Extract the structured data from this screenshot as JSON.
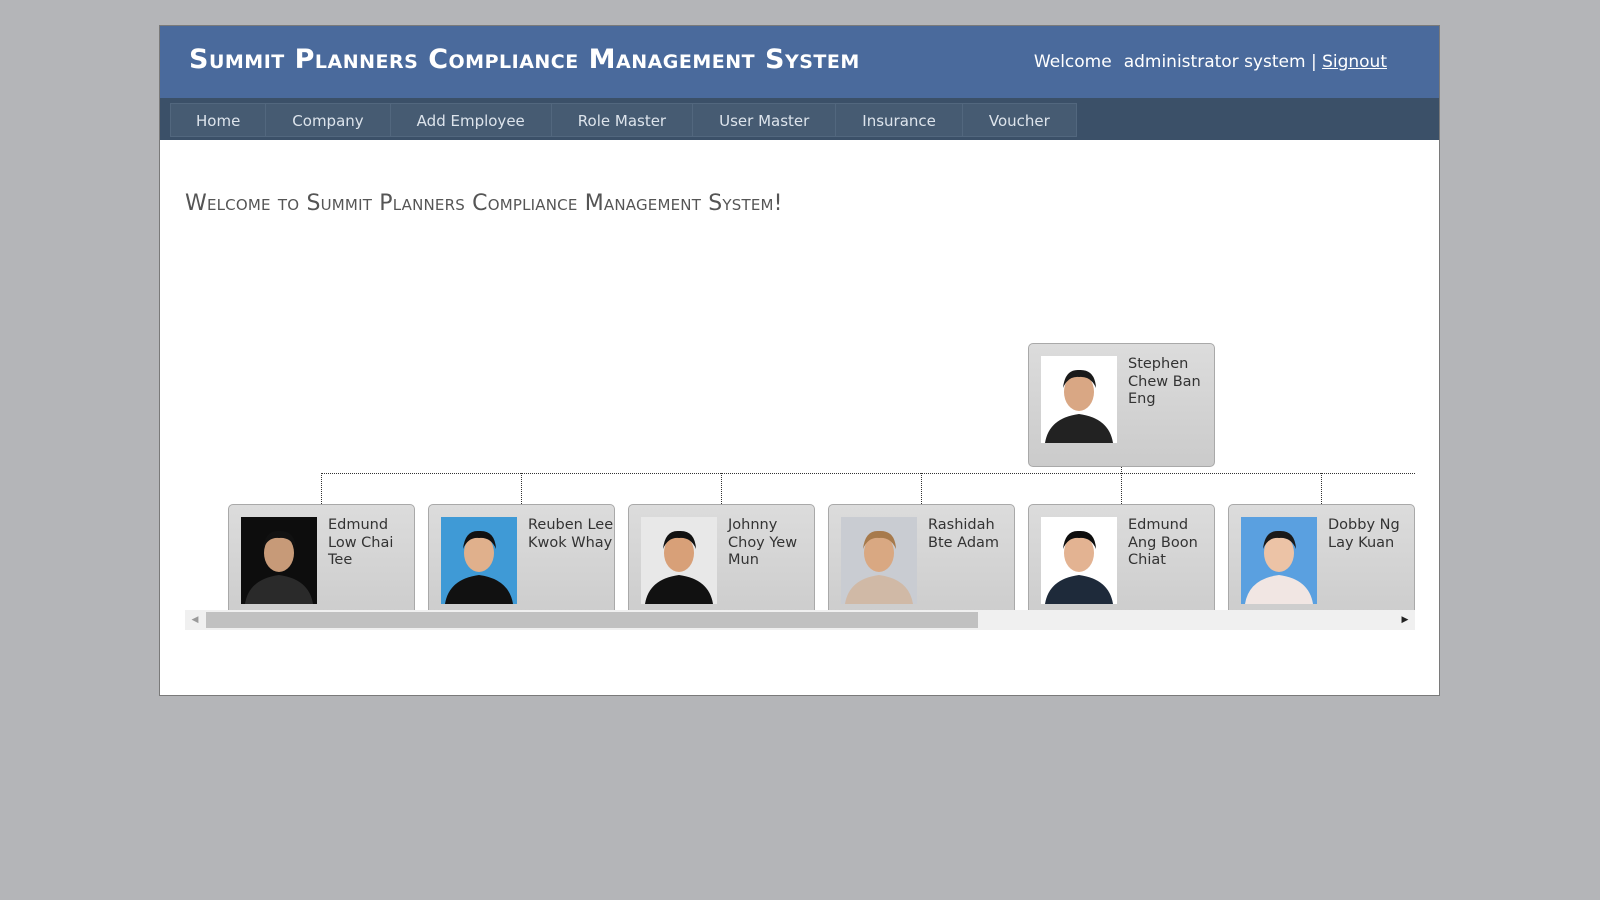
{
  "header": {
    "app_title": "Summit Planners Compliance Management System",
    "welcome_label": "Welcome",
    "username": "administrator system",
    "separator": "|",
    "signout_label": "Signout"
  },
  "nav": {
    "items": [
      {
        "label": "Home"
      },
      {
        "label": "Company"
      },
      {
        "label": "Add Employee"
      },
      {
        "label": "Role Master"
      },
      {
        "label": "User Master"
      },
      {
        "label": "Insurance"
      },
      {
        "label": "Voucher"
      }
    ]
  },
  "main": {
    "heading": "Welcome to Summit Planners Compliance Management System!"
  },
  "org_chart": {
    "root": {
      "name": "Stephen Chew Ban Eng",
      "photo": "portrait-man-glasses-white-bg"
    },
    "children": [
      {
        "name": "Edmund Low Chai Tee",
        "photo": "portrait-man-dark-bg"
      },
      {
        "name": "Reuben Lee Kwok Whay",
        "photo": "portrait-man-blue-bg"
      },
      {
        "name": "Johnny Choy Yew Mun",
        "photo": "portrait-man-tuxedo"
      },
      {
        "name": "Rashidah Bte Adam",
        "photo": "portrait-woman-long-hair"
      },
      {
        "name": "Edmund Ang Boon Chiat",
        "photo": "portrait-man-white-bg"
      },
      {
        "name": "Dobby Ng Lay Kuan",
        "photo": "portrait-woman-blue-bg"
      }
    ],
    "scroll_position_fraction": 0.0,
    "visible_fraction": 0.65
  },
  "icons": {
    "scroll_left": "◀",
    "scroll_right": "▶"
  }
}
